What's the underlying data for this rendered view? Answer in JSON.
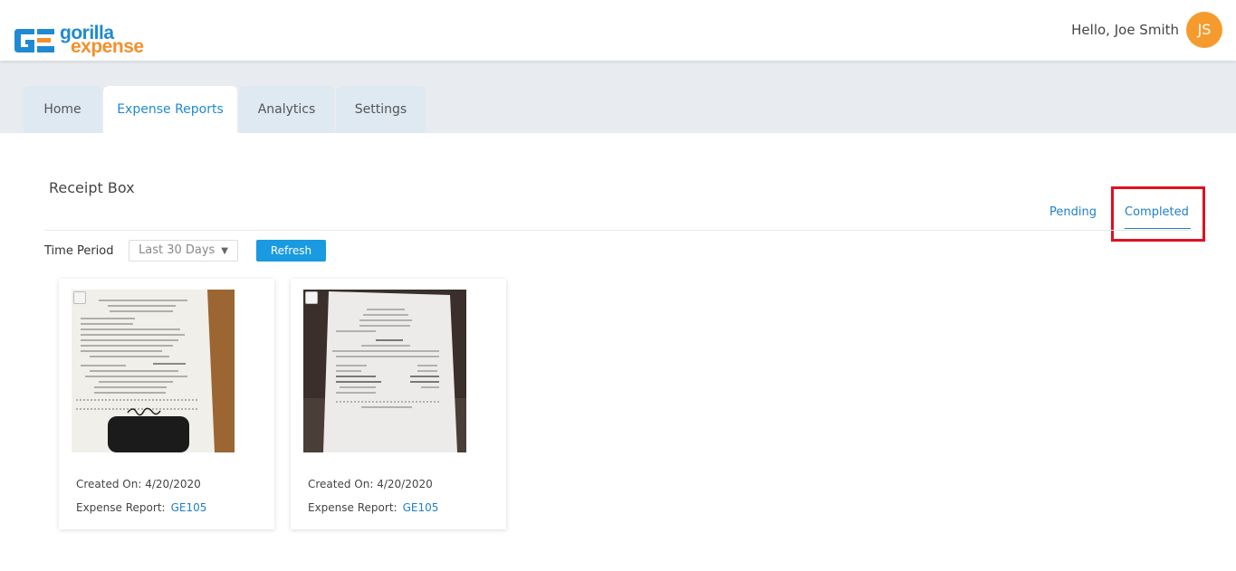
{
  "header": {
    "logo_line1": "gorilla",
    "logo_line2": "expense",
    "greeting": "Hello, Joe Smith",
    "avatar_initials": "JS"
  },
  "tabs": [
    {
      "label": "Home",
      "active": false
    },
    {
      "label": "Expense Reports",
      "active": true
    },
    {
      "label": "Analytics",
      "active": false
    },
    {
      "label": "Settings",
      "active": false
    }
  ],
  "receipt_box": {
    "title": "Receipt Box",
    "filters": {
      "pending": "Pending",
      "completed": "Completed",
      "selected": "Completed"
    },
    "time_period_label": "Time Period",
    "time_period_value": "Last 30 Days",
    "refresh_label": "Refresh"
  },
  "receipts": [
    {
      "created_label": "Created On:",
      "created_on": "4/20/2020",
      "report_label": "Expense Report:",
      "report_id": "GE105",
      "image": "restaurant-receipt-image"
    },
    {
      "created_label": "Created On:",
      "created_on": "4/20/2020",
      "report_label": "Expense Report:",
      "report_id": "GE105",
      "image": "cafe-receipt-image"
    }
  ],
  "colors": {
    "brand_blue": "#1f8ad1",
    "brand_orange": "#f2902c",
    "avatar": "#f59b2e",
    "button": "#1a9ae0",
    "highlight": "#e01020"
  }
}
